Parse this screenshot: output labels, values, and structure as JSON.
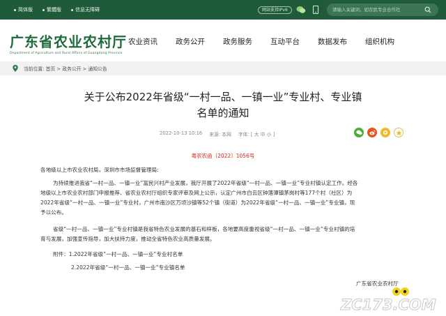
{
  "topbar": {
    "links": [
      "简体版",
      "繁體版",
      "信息无障碍"
    ],
    "ipv6_badge": "网站支持IPv6",
    "search_placeholder": "请输入关键词，如农民专业合作社"
  },
  "header": {
    "logo_title": "广东省农业农村厅",
    "logo_subtitle": "Department of Agriculture and Rural Affairs of Guangdong Province",
    "nav": [
      "农业资讯",
      "政务公开",
      "政务服务",
      "互动平台",
      "数据发布",
      "组织机构"
    ]
  },
  "breadcrumb": {
    "text": "当前位置: 首页 > 政务公开 > 通知公告"
  },
  "article": {
    "title_line1": "关于公布2022年省级“一村一品、一镇一业”专业村、专业镇",
    "title_line2": "名单的通知",
    "date": "2022-10-13 10:16",
    "source": "来源: 本网",
    "font_size": "字体: [ 大  中  小 ]",
    "doc_number": "粤农农函〔2022〕1056号",
    "salutation": "各地级以上市农业农村局，深圳市市场监督管理局:",
    "p1_line1": "为持续推进我省“一村一品、一镇一业”富民兴村产业发展，我厅开展了2022年省级“一村一品、一镇一业”专业村镇认定工作。经各",
    "p1_line2": "地级以上市农业农村部门申报推荐、省农业农村厅组织专家评审及网上公示，认定广州市白云区钟落潭镇茅岗村等177个村（社区）为",
    "p1_line3": "2022年省级“一村一品、一镇一业”专业村，广州市南沙区万顷沙镇等52个镇（街道）为2022年省级“一村一品、一镇一业”专业镇，现",
    "p1_line4": "予以公布。",
    "p2_line1": "省级“一村一品、一镇一业”专业村镇是我省特色农业发展的基石和样板，各地要高度重视省级“一村一品、一镇一业”专业村镇的培",
    "p2_line2": "育与发展，加强宣传指导，加大扶持力度，推动全省特色农业高质量发展。",
    "attach1": "附件：1.2022年省级“一村一品、一镇一业”专业村名单",
    "attach2": "2.2022年省级“一村一品、一镇一业”专业镇名单",
    "signature": "广东省农业农村厅"
  },
  "watermark": "ZC173.COM",
  "colors": {
    "topbar": "#1f5a3a",
    "brand_green": "#1f6a3b",
    "doc_number_red": "#d8261c",
    "wechat_green": "#4cae32",
    "weibo_orange": "#e8541e",
    "star_yellow": "#f0b92a"
  },
  "icons": [
    "wechat-icon",
    "phone-icon",
    "search-icon",
    "location-pin-icon",
    "share-wechat-icon",
    "share-weibo-icon",
    "share-qzone-icon",
    "favorite-star-icon"
  ]
}
